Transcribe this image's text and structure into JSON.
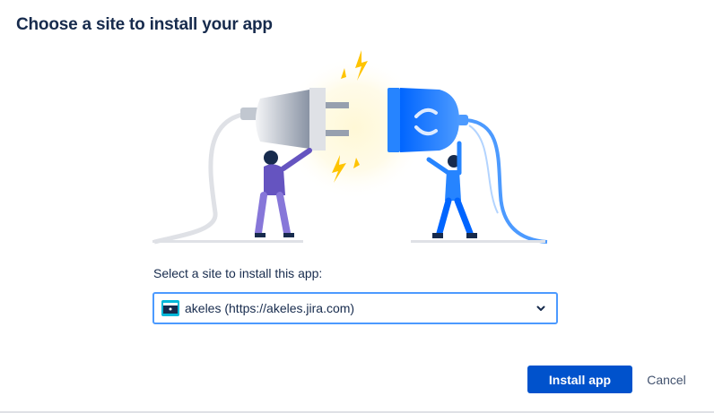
{
  "dialog": {
    "title": "Choose a site to install your app"
  },
  "illustration": {
    "plug_left_icon": "electric-plug-icon",
    "plug_right_icon": "confluence-plug-icon",
    "spark_icon": "lightning-icon",
    "colors": {
      "plug_gray": "#c1c7d0",
      "plug_blue": "#2684ff",
      "spark_yellow": "#ffc400",
      "person_purple": "#6554c0"
    }
  },
  "site_picker": {
    "label": "Select a site to install this app:",
    "selected_value": "akeles (https://akeles.jira.com)",
    "site_icon": "site-avatar-icon",
    "chevron_icon": "chevron-down-icon"
  },
  "actions": {
    "install_label": "Install app",
    "cancel_label": "Cancel"
  },
  "theme": {
    "primary": "#0052cc",
    "focus_border": "#4c9aff",
    "text": "#172b4d",
    "subtle_text": "#42526e"
  }
}
